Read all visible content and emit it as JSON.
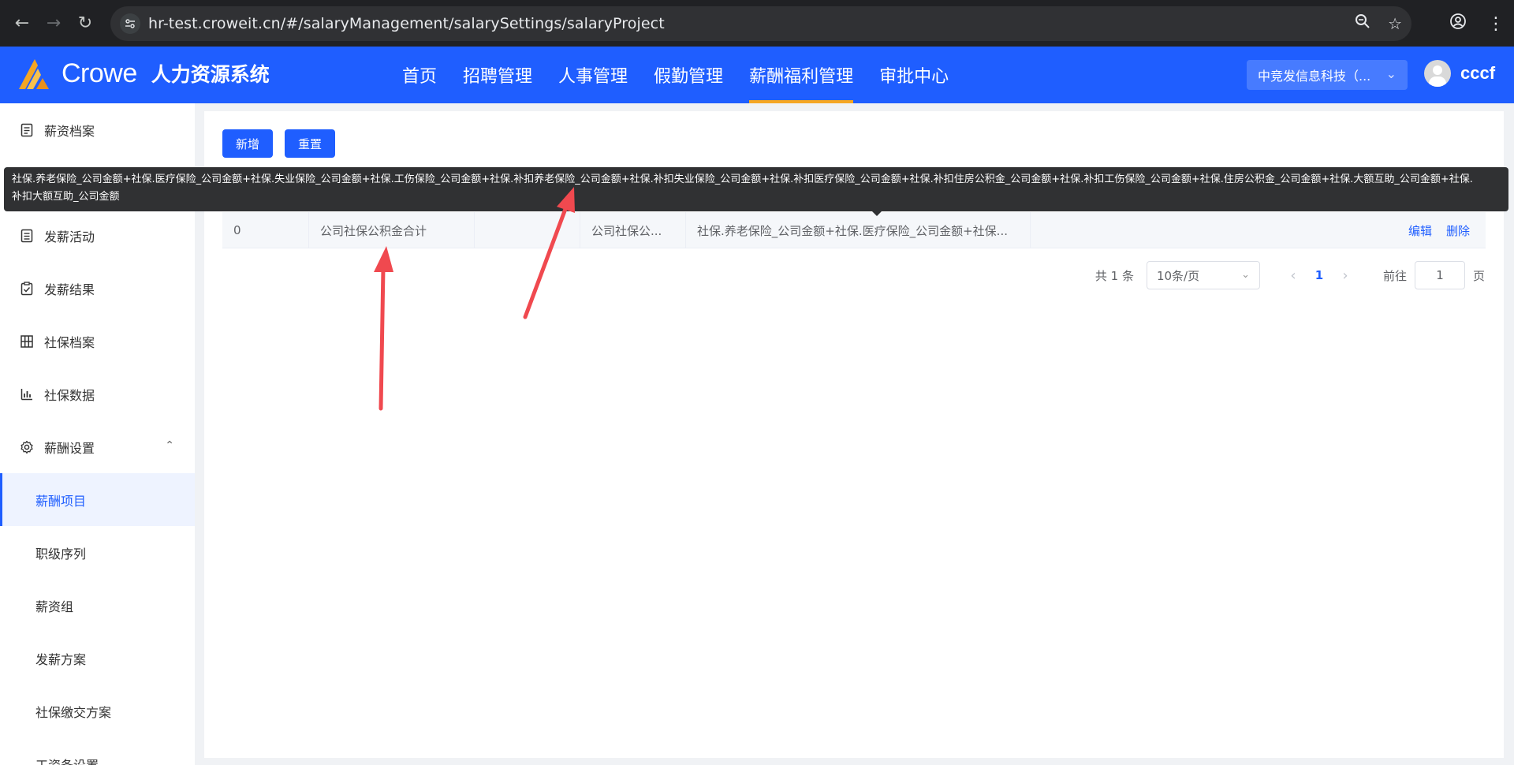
{
  "browser": {
    "url": "hr-test.croweit.cn/#/salaryManagement/salarySettings/salaryProject"
  },
  "header": {
    "logo_text": "Crowe",
    "system_name": "人力资源系统",
    "nav": [
      {
        "label": "首页",
        "active": false
      },
      {
        "label": "招聘管理",
        "active": false
      },
      {
        "label": "人事管理",
        "active": false
      },
      {
        "label": "假勤管理",
        "active": false
      },
      {
        "label": "薪酬福利管理",
        "active": true
      },
      {
        "label": "审批中心",
        "active": false
      }
    ],
    "company": "中竞发信息科技（...",
    "username": "cccf"
  },
  "sidebar": {
    "items": [
      {
        "label": "薪资档案",
        "icon": "document-icon"
      },
      {
        "label": "发薪活动",
        "icon": "list-icon"
      },
      {
        "label": "发薪结果",
        "icon": "check-clipboard-icon"
      },
      {
        "label": "社保档案",
        "icon": "grid-icon"
      },
      {
        "label": "社保数据",
        "icon": "bar-chart-icon"
      },
      {
        "label": "薪酬设置",
        "icon": "gear-icon",
        "expanded": true
      }
    ],
    "sub_items": [
      {
        "label": "薪酬项目",
        "active": true
      },
      {
        "label": "职级序列",
        "active": false
      },
      {
        "label": "薪资组",
        "active": false
      },
      {
        "label": "发薪方案",
        "active": false
      },
      {
        "label": "社保缴交方案",
        "active": false
      },
      {
        "label": "工资条设置",
        "active": false
      }
    ]
  },
  "toolbar": {
    "add_label": "新增",
    "reset_label": "重置"
  },
  "table": {
    "rows": [
      {
        "cells": [
          "0",
          "公司社保公积金合计",
          "",
          "公司社保公...",
          "社保.养老保险_公司金额+社保.医疗保险_公司金额+社保..."
        ],
        "edit_label": "编辑",
        "delete_label": "删除"
      }
    ]
  },
  "pagination": {
    "total_text": "共 1 条",
    "page_size": "10条/页",
    "current_page": "1",
    "goto_label": "前往",
    "goto_value": "1",
    "page_suffix": "页"
  },
  "tooltip": {
    "line1": "社保.养老保险_公司金额+社保.医疗保险_公司金额+社保.失业保险_公司金额+社保.工伤保险_公司金额+社保.补扣养老保险_公司金额+社保.补扣失业保险_公司金额+社保.补扣医疗保险_公司金额+社保.补扣住房公积金_公司金额+社保.补扣工伤保险_公司金额+社保.住房公积金_公司金额+社保.大额互助_公司金额+社保.",
    "line2": "补扣大额互助_公司金额"
  },
  "colors": {
    "brand_blue": "#1f5eff",
    "accent_orange": "#f5a623",
    "annotation_red": "#f0494f"
  }
}
